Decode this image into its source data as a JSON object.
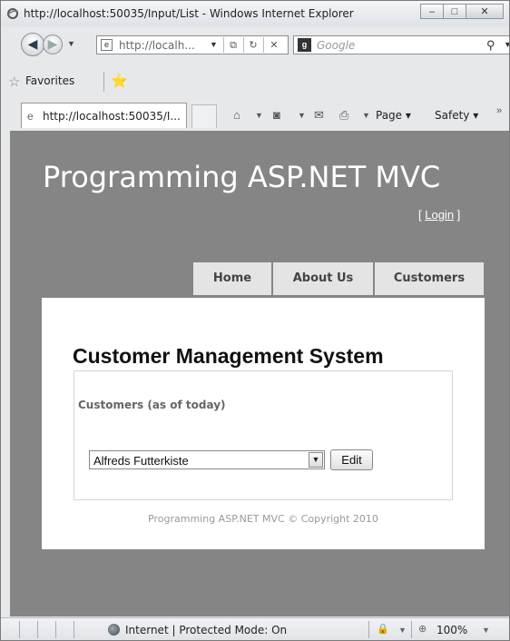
{
  "window": {
    "title": "http://localhost:50035/Input/List - Windows Internet Explorer"
  },
  "address_bar": {
    "url": "http://localh...",
    "search_placeholder": "Google"
  },
  "favorites_bar": {
    "favorites_label": "Favorites"
  },
  "tab": {
    "label": "http://localhost:50035/I..."
  },
  "command_bar": {
    "page_label": "Page",
    "safety_label": "Safety"
  },
  "site": {
    "title": "Programming ASP.NET MVC",
    "login_prefix": "[ ",
    "login_link": "Login",
    "login_suffix": " ]",
    "menu": [
      {
        "label": "Home"
      },
      {
        "label": "About Us"
      },
      {
        "label": "Customers"
      }
    ]
  },
  "main": {
    "page_title": "Customer Management System",
    "fieldset_legend": "Customers (as of today)",
    "customer_select_value": "Alfreds Futterkiste",
    "edit_button": "Edit",
    "footer": "Programming ASP.NET MVC © Copyright 2010"
  },
  "status_bar": {
    "zone_text": "Internet | Protected Mode: On",
    "zoom": "100%"
  }
}
